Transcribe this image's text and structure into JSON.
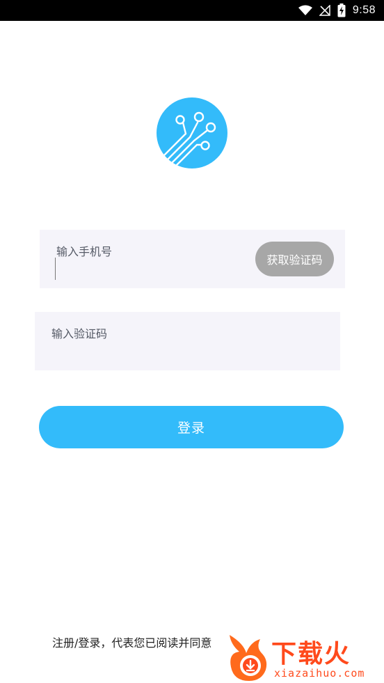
{
  "status_bar": {
    "time": "9:58",
    "icons": [
      "wifi-icon",
      "no-signal-icon",
      "battery-charging-icon"
    ]
  },
  "logo": {
    "icon": "circuit-logo-icon",
    "color": "#33bbfa"
  },
  "phone_field": {
    "label": "输入手机号",
    "value": "",
    "get_code_label": "获取验证码"
  },
  "code_field": {
    "label": "输入验证码",
    "value": ""
  },
  "login_button": {
    "label": "登录"
  },
  "agreement": {
    "text": "注册/登录，代表您已阅读并同意"
  },
  "watermark": {
    "brand": "下载火",
    "url": "xiazaihuo.com"
  },
  "colors": {
    "accent": "#33bbfa",
    "disabled_button": "#a7a7a7",
    "field_background": "#f5f4fa",
    "watermark": "#ff4a1c"
  }
}
